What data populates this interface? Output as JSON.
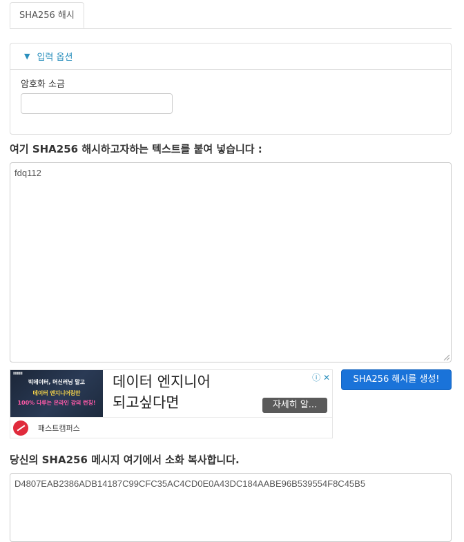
{
  "tabs": [
    {
      "label": "SHA256 해시"
    }
  ],
  "options": {
    "header": "입력 옵션",
    "salt_label": "암호화 소금",
    "salt_value": ""
  },
  "input": {
    "label": "여기 SHA256 해시하고자하는 텍스트를 붙여 넣습니다 :",
    "value": "fdq112"
  },
  "ad": {
    "image_line1": "빅데이터, 머신러닝 말고",
    "image_line2": "데이터 엔지니어링만",
    "image_line3": "100% 다루는 온라인 강의 런칭!",
    "headline_line1": "데이터 엔지니어",
    "headline_line2": "되고싶다면",
    "cta": "자세히 알...",
    "brand": "패스트캠퍼스",
    "choices": "ⓘ ✕"
  },
  "generate_button": "SHA256 해시를 생성!",
  "output": {
    "label": "당신의 SHA256 메시지 여기에서 소화 복사합니다.",
    "value": "D4807EAB2386ADB14187C99CFC35AC4CD0E0A43DC184AABE96B539554F8C45B5"
  },
  "colors": {
    "accent": "#2a8fbd",
    "button": "#1a73d9",
    "border": "#dddddd"
  }
}
